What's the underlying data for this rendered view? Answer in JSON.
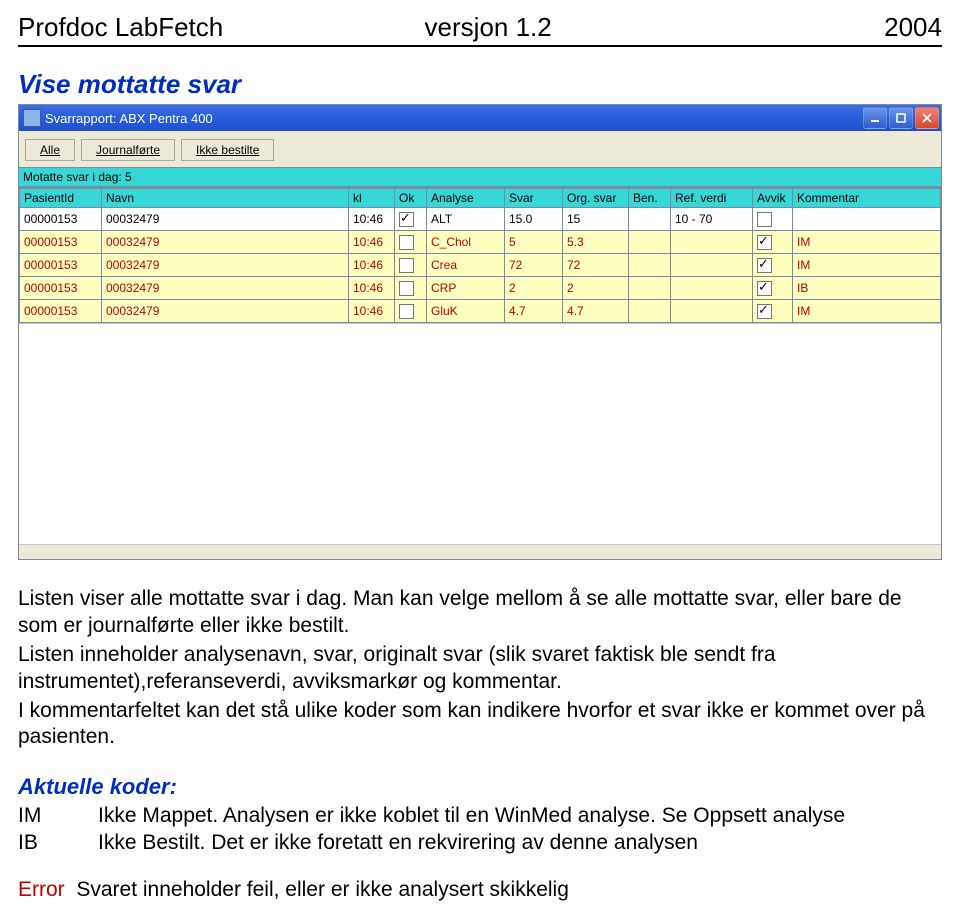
{
  "doc": {
    "product": "Profdoc LabFetch",
    "version": "versjon 1.2",
    "year": "2004",
    "section_title": "Vise mottatte svar"
  },
  "window": {
    "title": "Svarrapport: ABX Pentra 400",
    "buttons": {
      "min": "minimize",
      "max": "maximize",
      "close": "close"
    }
  },
  "toolbar": {
    "all_label": "Alle",
    "journal_label": "Journalførte",
    "notordered_label": "Ikke bestilte"
  },
  "status": {
    "text": "Motatte svar i dag: 5"
  },
  "grid": {
    "columns": [
      "PasientId",
      "Navn",
      "kl",
      "Ok",
      "Analyse",
      "Svar",
      "Org. svar",
      "Ben.",
      "Ref. verdi",
      "Avvik",
      "Kommentar"
    ],
    "rows": [
      {
        "pid": "00000153",
        "navn": "00032479",
        "kl": "10:46",
        "ok": true,
        "analyse": "ALT",
        "svar": "15.0",
        "org": "15",
        "ben": "",
        "ref": "10 - 70",
        "avvik": false,
        "kom": ""
      },
      {
        "pid": "00000153",
        "navn": "00032479",
        "kl": "10:46",
        "ok": false,
        "analyse": "C_Chol",
        "svar": "5",
        "org": "5.3",
        "ben": "",
        "ref": "",
        "avvik": true,
        "kom": "IM"
      },
      {
        "pid": "00000153",
        "navn": "00032479",
        "kl": "10:46",
        "ok": false,
        "analyse": "Crea",
        "svar": "72",
        "org": "72",
        "ben": "",
        "ref": "",
        "avvik": true,
        "kom": "IM"
      },
      {
        "pid": "00000153",
        "navn": "00032479",
        "kl": "10:46",
        "ok": false,
        "analyse": "CRP",
        "svar": "2",
        "org": "2",
        "ben": "",
        "ref": "",
        "avvik": true,
        "kom": "IB"
      },
      {
        "pid": "00000153",
        "navn": "00032479",
        "kl": "10:46",
        "ok": false,
        "analyse": "GluK",
        "svar": "4.7",
        "org": "4.7",
        "ben": "",
        "ref": "",
        "avvik": true,
        "kom": "IM"
      }
    ]
  },
  "explain": {
    "p1": "Listen viser alle mottatte svar i dag. Man kan velge mellom å se alle mottatte svar, eller bare de som er journalførte eller ikke bestilt.",
    "p2": "Listen inneholder analysenavn, svar, originalt svar (slik svaret faktisk ble sendt fra instrumentet),referanseverdi,  avviksmarkør og kommentar.",
    "p3": "I kommentarfeltet kan det stå ulike koder som kan indikere hvorfor et svar ikke er kommet over på pasienten.",
    "codes_title": "Aktuelle koder:",
    "codes": [
      {
        "code": "IM",
        "desc": "Ikke Mappet. Analysen er ikke koblet til en WinMed analyse. Se Oppsett analyse"
      },
      {
        "code": "IB",
        "desc": "Ikke Bestilt. Det er ikke foretatt en rekvirering av denne analysen"
      }
    ],
    "error_label": "Error",
    "error_desc": "Svaret inneholder feil, eller er ikke analysert skikkelig"
  }
}
